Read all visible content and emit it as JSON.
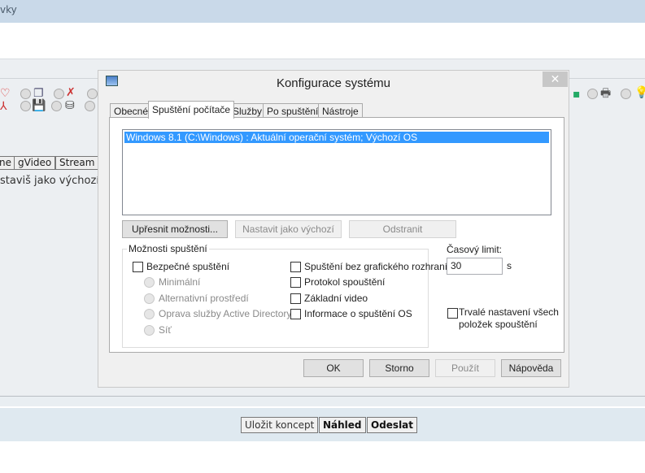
{
  "page": {
    "top_text": "vky",
    "editor_buttons": [
      "ne",
      "gVideo",
      "Stream"
    ],
    "hint_text": "staviš jako výchozí c",
    "footer_buttons": {
      "save_draft": "Uložit koncept",
      "preview": "Náhled",
      "send": "Odeslat"
    }
  },
  "dialog": {
    "title": "Konfigurace systému",
    "close": "✕",
    "tabs": [
      "Obecné",
      "Spuštění počítače",
      "Služby",
      "Po spuštění",
      "Nástroje"
    ],
    "active_tab": "Spuštění počítače",
    "boot_entries": [
      "Windows 8.1 (C:\\Windows) : Aktuální operační systém; Výchozí OS"
    ],
    "buttons": {
      "advanced": "Upřesnit možnosti...",
      "set_default": "Nastavit jako výchozí",
      "delete": "Odstranit"
    },
    "boot_options": {
      "label": "Možnosti spuštění",
      "safe_boot": {
        "label": "Bezpečné spuštění",
        "checked": false
      },
      "safe_modes": [
        "Minimální",
        "Alternativní prostředí",
        "Oprava služby Active Directory",
        "Síť"
      ],
      "no_gui": {
        "label": "Spuštění bez grafického rozhraní",
        "checked": false
      },
      "boot_log": {
        "label": "Protokol spouštění",
        "checked": false
      },
      "base_video": {
        "label": "Základní video",
        "checked": false
      },
      "os_info": {
        "label": "Informace o spuštění OS",
        "checked": false
      }
    },
    "timeout": {
      "label": "Časový limit:",
      "value": "30",
      "unit": "s"
    },
    "permanent": {
      "label_line1": "Trvalé nastavení všech",
      "label_line2": "položek spouštění",
      "checked": false
    },
    "footer": {
      "ok": "OK",
      "cancel": "Storno",
      "apply": "Použít",
      "help": "Nápověda"
    }
  }
}
